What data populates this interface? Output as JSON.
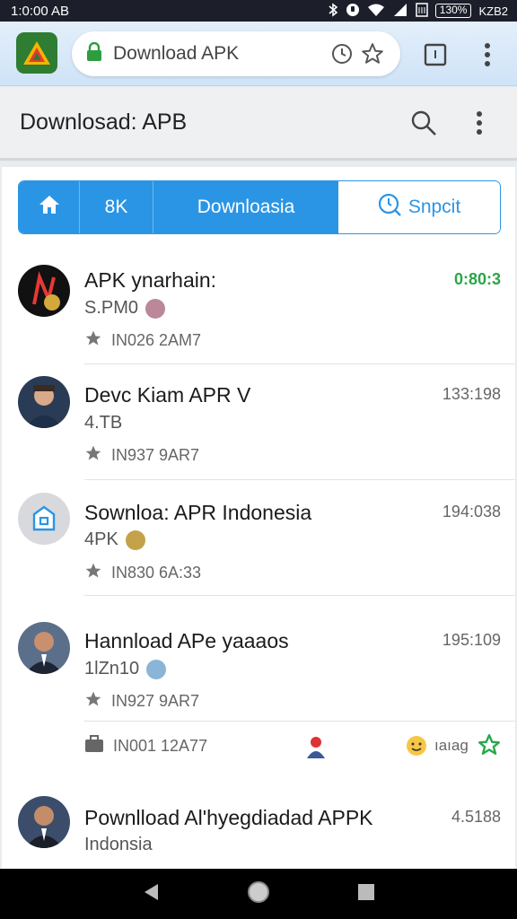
{
  "status_bar": {
    "time": "1:0:00 ΑΒ",
    "battery": "130%",
    "right_text": "ΚΖΒ2"
  },
  "browser": {
    "url": "Download APK"
  },
  "header": {
    "title": "Downlosad: APB"
  },
  "tabs": [
    {
      "label": ""
    },
    {
      "label": "8K"
    },
    {
      "label": "Downloasia"
    },
    {
      "label": "Snpcit"
    }
  ],
  "items": [
    {
      "title": "APK ynarhain:",
      "time": "0:80:3",
      "sub": "S.PM0",
      "meta": "IN026  2AM7"
    },
    {
      "title": "Devc Kiam APR V",
      "time": "133:198",
      "sub": "4.TB",
      "meta": "IN937  9AR7"
    },
    {
      "title": "Sownloa: APR Indonesia",
      "time": "194:038",
      "sub": "4PK",
      "meta": "IN830  6A:33"
    },
    {
      "title": "Hannload APe yaaaos",
      "time": "195:109",
      "sub": "1lZn10",
      "meta": "IN927  9AR7",
      "meta2": "IN001  12A77",
      "meta2_tag": "ıaıag"
    },
    {
      "title": "Pownlload Al'hyegdiadad APPK",
      "time": "4.5188",
      "sub": "Indonsia"
    }
  ],
  "colors": {
    "accent": "#2b95e5",
    "green": "#28a745"
  }
}
